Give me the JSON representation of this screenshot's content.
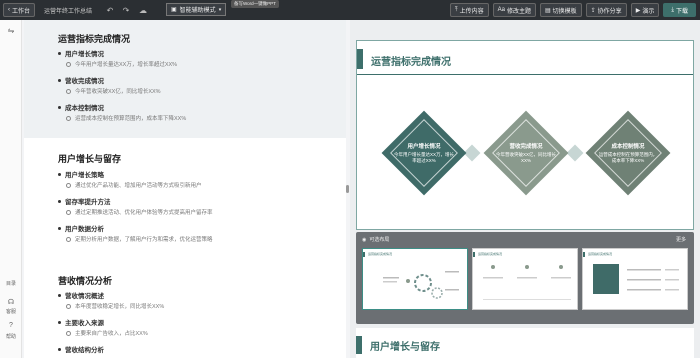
{
  "toolbar": {
    "workbench": "工作台",
    "doc_title": "运营年终工作总结",
    "mode": "智能辅助模式",
    "tooltip": "备写Word一键做PPT",
    "upload": "上传内容",
    "theme": "修改主题",
    "switch_template": "切换模板",
    "collab": "协作分享",
    "present": "演示",
    "download": "下载"
  },
  "rail": {
    "label1": "目录",
    "label2": "客服",
    "label3": "帮助"
  },
  "outline": [
    {
      "title": "运营指标完成情况",
      "items": [
        {
          "h2": "用户增长情况",
          "h3": "今年用户增长量达XX万，增长率超过XX%"
        },
        {
          "h2": "营收完成情况",
          "h3": "今年营收突破XX亿，同比增长XX%"
        },
        {
          "h2": "成本控制情况",
          "h3": "运营成本控制在预算范围内，成本率下降XX%"
        }
      ]
    },
    {
      "title": "用户增长与留存",
      "items": [
        {
          "h2": "用户增长策略",
          "h3": "通过优化产品功能、增加用户活动等方式吸引新用户"
        },
        {
          "h2": "留存率提升方法",
          "h3": "通过定期推送活动、优化用户体验等方式提高用户留存率"
        },
        {
          "h2": "用户数据分析",
          "h3": "定期分析用户数据，了解用户行为和需求，优化运营策略"
        }
      ]
    },
    {
      "title": "营收情况分析",
      "items": [
        {
          "h2": "营收情况概述",
          "h3": "本年度营收稳定增长，同比增长XX%"
        },
        {
          "h2": "主要收入来源",
          "h3": "主要来自广告收入，占比XX%"
        },
        {
          "h2": "营收结构分析",
          "h3": ""
        }
      ]
    }
  ],
  "slide": {
    "title": "运营指标完成情况",
    "cards": [
      {
        "title": "用户增长情况",
        "desc": "今年用户增长量达XX万，增长率超过XX%",
        "color": "#3f6b68"
      },
      {
        "title": "营收完成情况",
        "desc": "今年营收突破XX亿，同比增长XX%",
        "color": "#8a9a8d"
      },
      {
        "title": "成本控制情况",
        "desc": "运营成本控制在预算范围内，成本率下降XX%",
        "color": "#6f8175"
      }
    ]
  },
  "thumbs": {
    "head": "可选布局",
    "close": "更多",
    "items": [
      {
        "title": "运营指标完成情况"
      },
      {
        "title": "运营指标完成情况"
      },
      {
        "title": "运营指标完成情况"
      }
    ]
  },
  "slide2": {
    "title": "用户增长与留存"
  },
  "colors": {
    "accent": "#3d6f6b",
    "toolbar": "#2b2f33"
  }
}
